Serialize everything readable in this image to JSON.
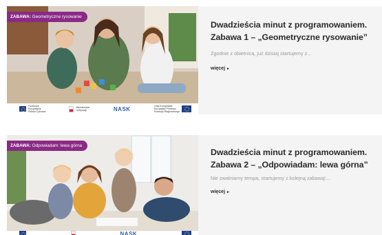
{
  "posts": [
    {
      "tag_prefix": "ZABAWA:",
      "tag_text": " Geometryczne rysowanie",
      "title_line1": "Dwadzieścia minut z programowaniem.",
      "title_line2": "Zabawa 1 – „Geometryczne rysowanie”",
      "excerpt": "Zgodnie z obietnicą, już dzisiaj startujemy z...",
      "more_label": "więcej",
      "more_icon": "chevron-right-icon"
    },
    {
      "tag_prefix": "ZABAWA:",
      "tag_text": " Odpowiadam: lewa górna",
      "title_line1": "Dwadzieścia minut z programowaniem.",
      "title_line2": "Zabawa 2 – „Odpowiadam: lewa górna”",
      "excerpt": "Nie zwalniamy tempa, startujemy z kolejną zabawą!...",
      "more_label": "więcej",
      "more_icon": "chevron-right-icon"
    }
  ],
  "logos": {
    "eu_funds_line1": "Fundusze",
    "eu_funds_line2": "Europejskie",
    "eu_funds_line3": "Polska Cyfrowa",
    "ministry_line1": "Ministerstwo",
    "ministry_line2": "Cyfryzacji",
    "nask": "NASK",
    "ue_line1": "Unia Europejska",
    "ue_line2": "Europejski Fundusz",
    "ue_line3": "Rozwoju Regionalnego"
  },
  "colors": {
    "tag_bg": "#8a2a86",
    "card_bg": "#f4f4f4",
    "title": "#2b2b2b",
    "excerpt": "#9a9a9a"
  }
}
